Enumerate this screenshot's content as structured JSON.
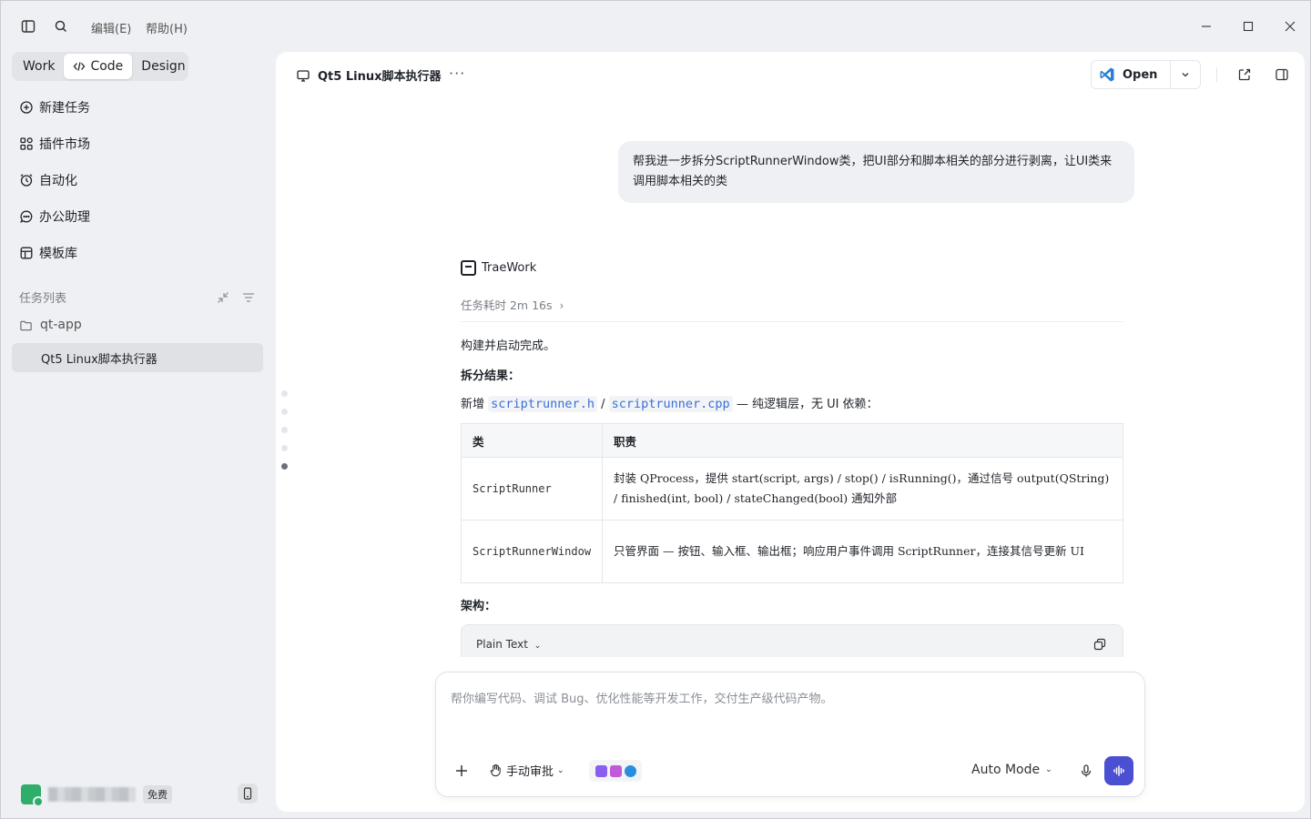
{
  "menu": {
    "edit_label": "编辑(E)",
    "help_label": "帮助(H)"
  },
  "sidebar": {
    "modes": [
      {
        "label": "Work"
      },
      {
        "label": "Code"
      },
      {
        "label": "Design"
      }
    ],
    "items": [
      {
        "label": "新建任务",
        "icon": "plus-circle-icon"
      },
      {
        "label": "插件市场",
        "icon": "grid-icon"
      },
      {
        "label": "自动化",
        "icon": "alarm-icon"
      },
      {
        "label": "办公助理",
        "icon": "chat-icon"
      },
      {
        "label": "模板库",
        "icon": "table-icon"
      }
    ],
    "task_list_title": "任务列表",
    "folder_label": "qt-app",
    "active_task": "Qt5 Linux脚本执行器",
    "user_badge": "免费"
  },
  "main": {
    "project_title": "Qt5 Linux脚本执行器",
    "open_label": "Open",
    "user_message": "帮我进一步拆分ScriptRunnerWindow类，把UI部分和脚本相关的部分进行剥离，让UI类来调用脚本相关的类",
    "bot_name": "TraeWork",
    "elapsed": "任务耗时 2m 16s",
    "line1": "构建并启动完成。",
    "line2": "拆分结果：",
    "line3_prefix": "新增",
    "file_h": "scriptrunner.h",
    "slash": "/",
    "file_cpp": "scriptrunner.cpp",
    "line3_suffix": "— 纯逻辑层，无 UI 依赖：",
    "table": {
      "headers": [
        "类",
        "职责"
      ],
      "rows": [
        {
          "cls": "ScriptRunner",
          "duty": "封装 QProcess，提供 start(script, args) / stop() / isRunning()，通过信号 output(QString) / finished(int, bool) / stateChanged(bool) 通知外部"
        },
        {
          "cls": "ScriptRunnerWindow",
          "duty": "只管界面 — 按钮、输入框、输出框；响应用户事件调用 ScriptRunner，连接其信号更新 UI"
        }
      ]
    },
    "arch_title": "架构：",
    "code_lang": "Plain Text"
  },
  "composer": {
    "placeholder": "帮你编写代码、调试 Bug、优化性能等开发工作，交付生产级代码产物。",
    "approve_label": "手动审批",
    "mode_label": "Auto Mode"
  },
  "colors": {
    "accent": "#4b4fd1",
    "code_link": "#3a6fd8",
    "avatar": "#2fae6b"
  }
}
